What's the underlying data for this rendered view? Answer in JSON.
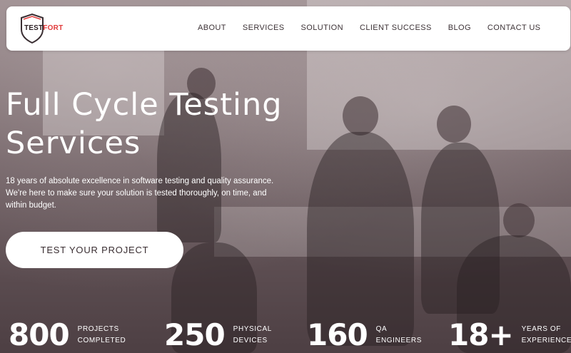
{
  "brand": {
    "logo_main": "TEST",
    "logo_accent": "FORT"
  },
  "nav": {
    "items": [
      {
        "label": "ABOUT"
      },
      {
        "label": "SERVICES"
      },
      {
        "label": "SOLUTION"
      },
      {
        "label": "CLIENT SUCCESS"
      },
      {
        "label": "BLOG"
      },
      {
        "label": "CONTACT US"
      }
    ]
  },
  "hero": {
    "title_line1": "Full Cycle Testing",
    "title_line2": "Services",
    "subtitle_line1": "18 years of absolute excellence in software testing and quality assurance.",
    "subtitle_line2": "We're here to make sure your solution is tested thoroughly, on time, and",
    "subtitle_line3": "within budget.",
    "cta_label": "TEST YOUR PROJECT"
  },
  "stats": [
    {
      "value": "800",
      "label_line1": "PROJECTS",
      "label_line2": "COMPLETED"
    },
    {
      "value": "250",
      "label_line1": "PHYSICAL",
      "label_line2": "DEVICES"
    },
    {
      "value": "160",
      "label_line1": "QA",
      "label_line2": "ENGINEERS"
    },
    {
      "value": "18+",
      "label_line1": "YEARS OF",
      "label_line2": "EXPERIENCE"
    }
  ],
  "colors": {
    "accent": "#e13b3b",
    "overlay": "#6f5f63",
    "text_dark": "#3c3236"
  }
}
